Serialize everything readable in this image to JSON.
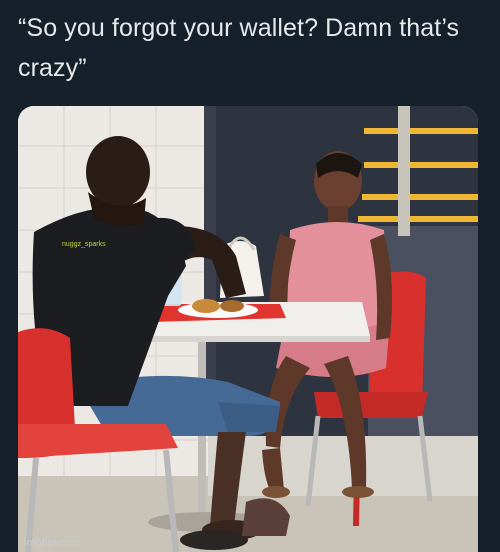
{
  "tweet": {
    "text": "“So you forgot your wallet? Damn that’s\ncrazy”"
  },
  "photo": {
    "shirt_print": "nuggz_sparks"
  },
  "watermark": {
    "text": "imgflip.com"
  },
  "colors": {
    "background": "#15202b",
    "text": "#e7e9ea",
    "chair": "#d8302c",
    "tray": "#e0342e",
    "dress": "#e3909a",
    "wall_dark": "#2e3340",
    "shelf": "#f0b636"
  }
}
